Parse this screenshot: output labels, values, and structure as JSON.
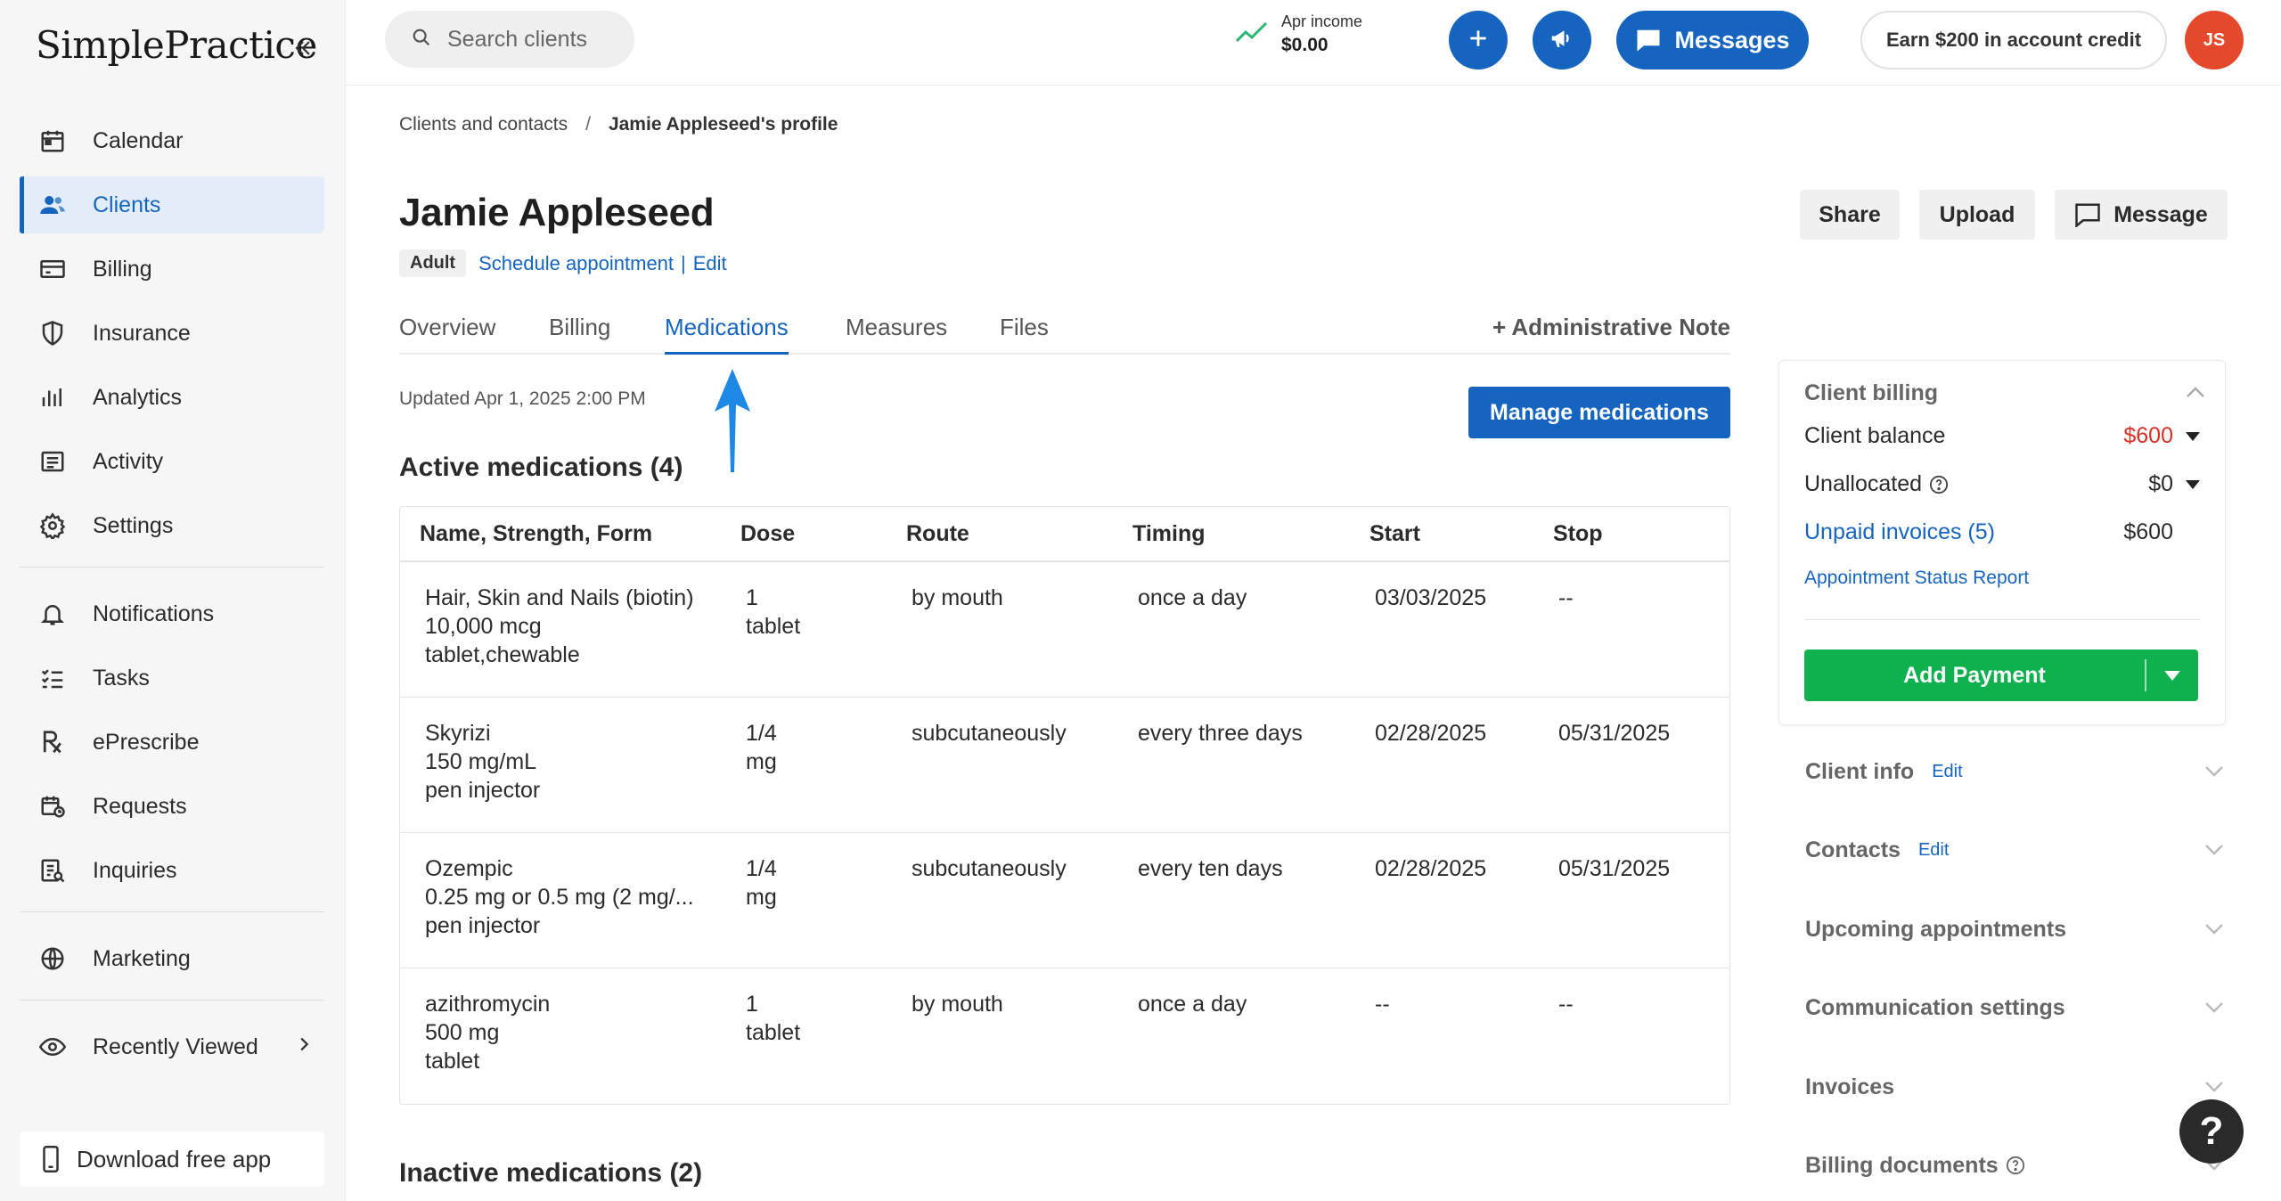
{
  "app": {
    "logo": "SimplePractice"
  },
  "sidebar": {
    "items": [
      {
        "label": "Calendar"
      },
      {
        "label": "Clients"
      },
      {
        "label": "Billing"
      },
      {
        "label": "Insurance"
      },
      {
        "label": "Analytics"
      },
      {
        "label": "Activity"
      },
      {
        "label": "Settings"
      },
      {
        "label": "Notifications"
      },
      {
        "label": "Tasks"
      },
      {
        "label": "ePrescribe"
      },
      {
        "label": "Requests"
      },
      {
        "label": "Inquiries"
      },
      {
        "label": "Marketing"
      },
      {
        "label": "Recently Viewed"
      }
    ],
    "active": "Clients",
    "download_app": "Download free app"
  },
  "topbar": {
    "search_placeholder": "Search clients",
    "income_label": "Apr income",
    "income_value": "$0.00",
    "messages_label": "Messages",
    "earn_label": "Earn $200 in account credit",
    "avatar_initials": "JS"
  },
  "breadcrumb": {
    "parent": "Clients and contacts",
    "separator": "/",
    "current": "Jamie Appleseed's profile"
  },
  "client": {
    "name": "Jamie Appleseed",
    "badge": "Adult",
    "schedule_link": "Schedule appointment",
    "pipe": "|",
    "edit_link": "Edit"
  },
  "actions": {
    "share": "Share",
    "upload": "Upload",
    "message": "Message"
  },
  "tabs": {
    "items": [
      "Overview",
      "Billing",
      "Medications",
      "Measures",
      "Files"
    ],
    "active": "Medications",
    "admin_note": "+ Administrative Note"
  },
  "medications": {
    "updated": "Updated Apr 1, 2025 2:00 PM",
    "manage_button": "Manage medications",
    "active_title": "Active medications (4)",
    "inactive_title": "Inactive medications (2)",
    "columns": [
      "Name, Strength, Form",
      "Dose",
      "Route",
      "Timing",
      "Start",
      "Stop"
    ],
    "rows": [
      {
        "name": "Hair, Skin and Nails (biotin)",
        "strength": "10,000 mcg",
        "form": "tablet,chewable",
        "dose1": "1",
        "dose2": "tablet",
        "route": "by mouth",
        "timing": "once a day",
        "start": "03/03/2025",
        "stop": "--"
      },
      {
        "name": "Skyrizi",
        "strength": "150 mg/mL",
        "form": "pen injector",
        "dose1": "1/4",
        "dose2": "mg",
        "route": "subcutaneously",
        "timing": "every three days",
        "start": "02/28/2025",
        "stop": "05/31/2025"
      },
      {
        "name": "Ozempic",
        "strength": "0.25 mg or 0.5 mg (2 mg/...",
        "form": "pen injector",
        "dose1": "1/4",
        "dose2": "mg",
        "route": "subcutaneously",
        "timing": "every ten days",
        "start": "02/28/2025",
        "stop": "05/31/2025"
      },
      {
        "name": "azithromycin",
        "strength": "500 mg",
        "form": "tablet",
        "dose1": "1",
        "dose2": "tablet",
        "route": "by mouth",
        "timing": "once a day",
        "start": "--",
        "stop": "--"
      }
    ]
  },
  "billing_card": {
    "title": "Client billing",
    "client_balance_label": "Client balance",
    "client_balance_value": "$600",
    "unallocated_label": "Unallocated",
    "unallocated_value": "$0",
    "unpaid_invoices_label": "Unpaid invoices (5)",
    "unpaid_invoices_value": "$600",
    "report_link": "Appointment Status Report",
    "add_payment": "Add Payment"
  },
  "accordions": {
    "client_info": "Client info",
    "contacts": "Contacts",
    "edit": "Edit",
    "upcoming": "Upcoming appointments",
    "communication": "Communication settings",
    "invoices": "Invoices",
    "billing_documents": "Billing documents"
  },
  "help": "?",
  "colors": {
    "accent": "#1565c0",
    "success": "#0fb14f",
    "danger": "#d93025",
    "avatar": "#e4492c"
  }
}
